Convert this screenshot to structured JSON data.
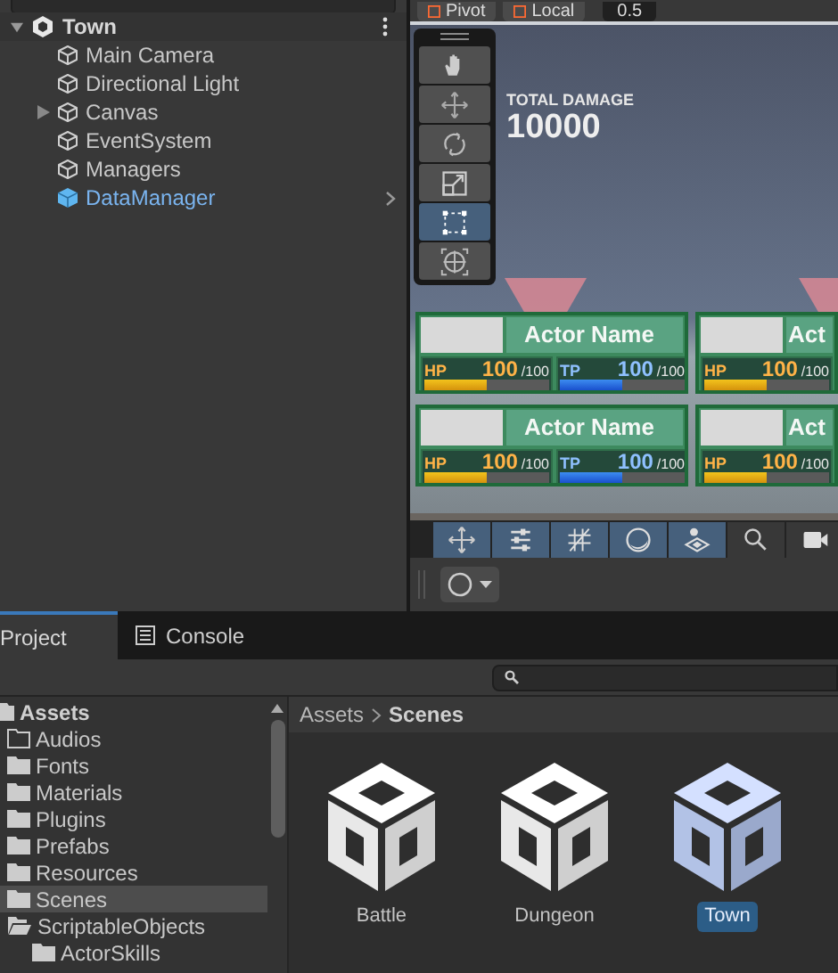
{
  "hierarchy": {
    "scene": "Town",
    "items": [
      {
        "name": "Main Camera",
        "kind": "object",
        "expandable": false
      },
      {
        "name": "Directional Light",
        "kind": "object",
        "expandable": false
      },
      {
        "name": "Canvas",
        "kind": "object",
        "expandable": true
      },
      {
        "name": "EventSystem",
        "kind": "object",
        "expandable": false
      },
      {
        "name": "Managers",
        "kind": "object",
        "expandable": false
      },
      {
        "name": "DataManager",
        "kind": "prefab",
        "expandable": false
      }
    ]
  },
  "scene_view": {
    "toolbar": [
      "Pivot",
      "Local",
      "0.5"
    ],
    "tools": [
      {
        "kind": "hand",
        "selected": false
      },
      {
        "kind": "move",
        "selected": false
      },
      {
        "kind": "rotate",
        "selected": false
      },
      {
        "kind": "scale",
        "selected": false
      },
      {
        "kind": "rect",
        "selected": true
      },
      {
        "kind": "transform",
        "selected": false
      }
    ],
    "game": {
      "total_label": "TOTAL DAMAGE",
      "total_value": "10000",
      "cards": [
        {
          "name": "Actor Name",
          "stats": [
            {
              "kind": "hp",
              "label": "HP",
              "value": "100",
              "max": "/100",
              "level": 0.5
            },
            {
              "kind": "tp",
              "label": "TP",
              "value": "100",
              "max": "/100",
              "level": 0.5
            }
          ]
        },
        {
          "name": "Act",
          "stats": [
            {
              "kind": "hp",
              "label": "HP",
              "value": "100",
              "max": "/100",
              "level": 0.5
            }
          ]
        },
        {
          "name": "Actor Name",
          "stats": [
            {
              "kind": "hp",
              "label": "HP",
              "value": "100",
              "max": "/100",
              "level": 0.5
            },
            {
              "kind": "tp",
              "label": "TP",
              "value": "100",
              "max": "/100",
              "level": 0.5
            }
          ]
        },
        {
          "name": "Act",
          "stats": [
            {
              "kind": "hp",
              "label": "HP",
              "value": "100",
              "max": "/100",
              "level": 0.5
            }
          ]
        }
      ]
    },
    "overlay_tools": [
      {
        "kind": "move",
        "selected": true
      },
      {
        "kind": "sliders",
        "selected": true
      },
      {
        "kind": "grid",
        "selected": true
      },
      {
        "kind": "circle",
        "selected": true
      },
      {
        "kind": "layers",
        "selected": true
      },
      {
        "kind": "search",
        "selected": false
      },
      {
        "kind": "camera",
        "selected": false
      }
    ]
  },
  "project": {
    "tabs": [
      {
        "label": "Project",
        "kind": "project",
        "selected": true
      },
      {
        "label": "Console",
        "kind": "console",
        "selected": false
      }
    ],
    "tree": [
      {
        "name": "Assets",
        "kind": "root",
        "selected": false,
        "children": [
          {
            "name": "Audios",
            "kind": "empty",
            "selected": false
          },
          {
            "name": "Fonts",
            "kind": "folder",
            "selected": false
          },
          {
            "name": "Materials",
            "kind": "folder",
            "selected": false
          },
          {
            "name": "Plugins",
            "kind": "folder",
            "selected": false
          },
          {
            "name": "Prefabs",
            "kind": "folder",
            "selected": false
          },
          {
            "name": "Resources",
            "kind": "folder",
            "selected": false
          },
          {
            "name": "Scenes",
            "kind": "folder",
            "selected": true
          },
          {
            "name": "ScriptableObjects",
            "kind": "open",
            "selected": false,
            "children": [
              {
                "name": "ActorSkills",
                "kind": "folder",
                "selected": false
              }
            ]
          }
        ]
      }
    ],
    "breadcrumb": [
      "Assets",
      "Scenes"
    ],
    "assets": [
      {
        "name": "Battle",
        "selected": false
      },
      {
        "name": "Dungeon",
        "selected": false
      },
      {
        "name": "Town",
        "selected": true
      }
    ]
  }
}
